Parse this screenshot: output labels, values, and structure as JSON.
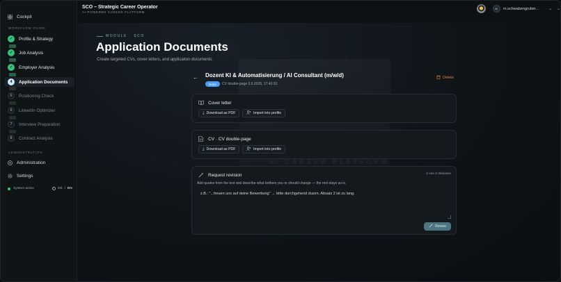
{
  "app": {
    "title": "SCO – Strategic Career Operator",
    "subtitle": "AI-POWERED CAREER PLATFORM"
  },
  "user": {
    "initials": "M.",
    "name": "m.schwabengruber..."
  },
  "sidebar": {
    "cockpit": "Cockpit",
    "workflow_label": "WORKFLOW GUIDE",
    "steps": [
      {
        "num": "1",
        "label": "Profile & Strategy",
        "state": "done"
      },
      {
        "num": "2",
        "label": "Job Analysis",
        "state": "done"
      },
      {
        "num": "3",
        "label": "Employer Analysis",
        "state": "done"
      },
      {
        "num": "4",
        "label": "Application Documents",
        "state": "current"
      },
      {
        "num": "5",
        "label": "Positioning Check",
        "state": "todo"
      },
      {
        "num": "6",
        "label": "LinkedIn Optimizer",
        "state": "todo"
      },
      {
        "num": "7",
        "label": "Interview Preparation",
        "state": "todo"
      },
      {
        "num": "8",
        "label": "Contract Analysis",
        "state": "todo"
      }
    ],
    "admin_label": "ADMINISTRATION",
    "administration": "Administration",
    "settings": "Settings",
    "status": "System active",
    "lang_de": "DE",
    "lang_sep": "/",
    "lang_en": "EN"
  },
  "main": {
    "module_label": "MODULE · SCO",
    "title": "Application Documents",
    "description": "Create targeted CVs, cover letters, and application documents.",
    "watermark": "AI CAREER PLATFORM"
  },
  "document": {
    "job_title": "Dozent KI & Automatisierung / AI Consultant (m/w/d)",
    "status_badge": "Done",
    "meta": "CV double-page  3.6.2026, 17:43:33",
    "delete_label": "Delete"
  },
  "cards": [
    {
      "title": "Cover letter",
      "download": "Download as PDF",
      "import": "Import into profile"
    },
    {
      "title": "CV · CV double-page",
      "download": "Download as PDF",
      "import": "Import into profile"
    }
  ],
  "revision": {
    "title": "Request revision",
    "counter": "2 von 2 Inklusive",
    "help": "Add quotes from the text and describe what bothers you or should change — the rest stays as is.",
    "placeholder": "z.B.: \"...freuen uns auf deine Bewerbung\" → bitte durchgehend duzen. Absatz 2 ist zu lang.",
    "button": "Revise"
  },
  "colors": {
    "accent_done": "#36c27a",
    "accent_badge": "#4aa0f0",
    "delete": "#e0863f",
    "module": "#7fb9a6"
  }
}
